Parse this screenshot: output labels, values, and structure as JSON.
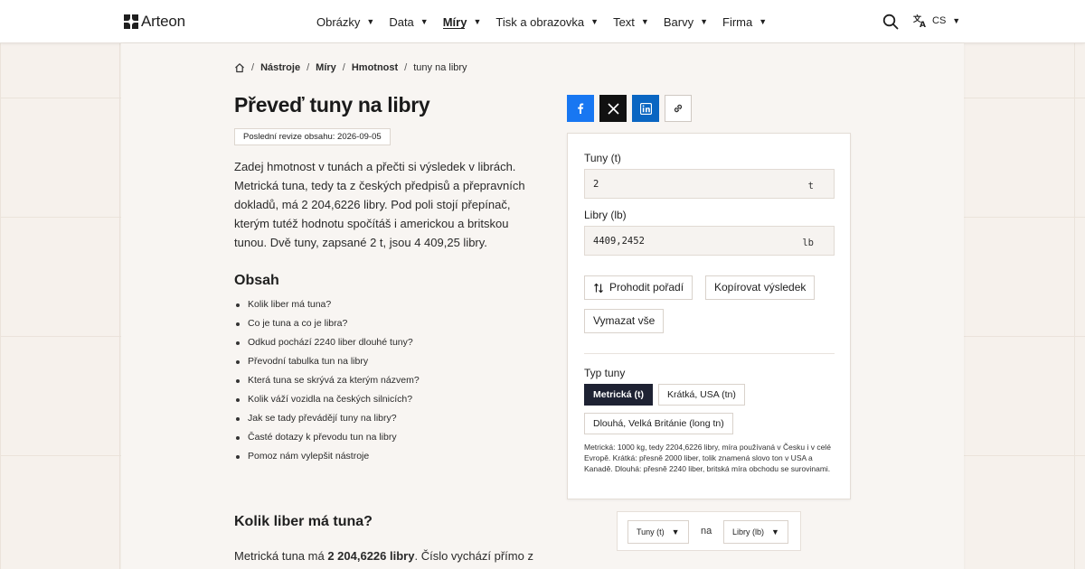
{
  "header": {
    "logo": "Arteon",
    "nav": [
      {
        "label": "Obrázky",
        "active": false
      },
      {
        "label": "Data",
        "active": false
      },
      {
        "label": "Míry",
        "active": true
      },
      {
        "label": "Tisk a obrazovka",
        "active": false
      },
      {
        "label": "Text",
        "active": false
      },
      {
        "label": "Barvy",
        "active": false
      },
      {
        "label": "Firma",
        "active": false
      }
    ],
    "lang": "CS",
    "icons": {
      "search": "search-icon",
      "translate": "translate-icon",
      "caret": "▼"
    }
  },
  "breadcrumb": {
    "items": [
      "Nástroje",
      "Míry",
      "Hmotnost"
    ],
    "current": "tuny na libry",
    "separator": "/"
  },
  "page": {
    "title": "Převeď tuny na libry",
    "revision": "Poslední revize obsahu: 2026-09-05",
    "intro": "Zadej hmotnost v tunách a přečti si výsledek v librách. Metrická tuna, tedy ta z českých předpisů a přepravních dokladů, má 2 204,6226 libry. Pod poli stojí přepínač, kterým tutéž hodnotu spočítáš i americkou a britskou tunou. Dvě tuny, zapsané 2 t, jsou 4 409,25 libry.",
    "toc_title": "Obsah",
    "toc": [
      "Kolik liber má tuna?",
      "Co je tuna a co je libra?",
      "Odkud pochází 2240 liber dlouhé tuny?",
      "Převodní tabulka tun na libry",
      "Která tuna se skrývá za kterým názvem?",
      "Kolik váží vozidla na českých silnicích?",
      "Jak se tady převádějí tuny na libry?",
      "Časté dotazy k převodu tun na libry",
      "Pomoz nám vylepšit nástroje"
    ],
    "section_title": "Kolik liber má tuna?",
    "section_text_before": "Metrická tuna má ",
    "section_text_bold": "2 204,6226 libry",
    "section_text_after": ". Číslo vychází přímo z"
  },
  "share": {
    "icons": [
      "facebook-icon",
      "x-icon",
      "linkedin-icon",
      "link-icon"
    ],
    "colors": {
      "facebook": "#1877f2",
      "x": "#111111",
      "linkedin": "#0a66c2"
    }
  },
  "converter": {
    "tons_label": "Tuny (t)",
    "tons_value": "2",
    "tons_unit": "t",
    "pounds_label": "Libry (lb)",
    "pounds_value": "4409,2452",
    "pounds_unit": "lb",
    "swap_label": "Prohodit pořadí",
    "copy_label": "Kopírovat výsledek",
    "clear_label": "Vymazat vše",
    "type_label": "Typ tuny",
    "types": [
      {
        "label": "Metrická (t)",
        "active": true
      },
      {
        "label": "Krátká, USA (tn)",
        "active": false
      },
      {
        "label": "Dlouhá, Velká Británie (long tn)",
        "active": false
      }
    ],
    "note": "Metrická: 1000 kg, tedy 2204,6226 libry, míra používaná v Česku i v celé Evropě. Krátká: přesně 2000 liber, tolik znamená slovo ton v USA a Kanadě. Dlouhá: přesně 2240 liber, britská míra obchodu se surovinami.",
    "accent": "#1e2233"
  },
  "unit_selector": {
    "from": "Tuny (t)",
    "connector": "na",
    "to": "Libry (lb)"
  }
}
